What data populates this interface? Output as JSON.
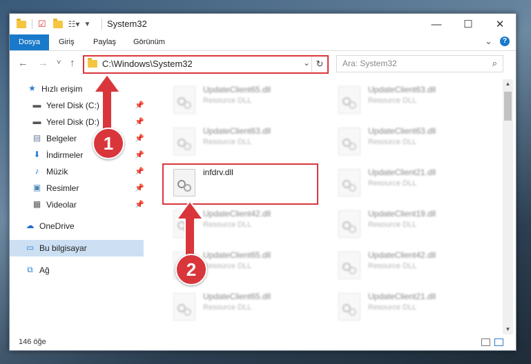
{
  "window": {
    "title": "System32"
  },
  "window_controls": {
    "minimize": "—",
    "maximize": "☐",
    "close": "✕"
  },
  "ribbon": {
    "tabs": [
      "Dosya",
      "Giriş",
      "Paylaş",
      "Görünüm"
    ],
    "collapse": "⌄",
    "help": "?"
  },
  "address": {
    "path": "C:\\Windows\\System32",
    "dropdown": "⌄",
    "refresh": "↻"
  },
  "search": {
    "placeholder": "Ara: System32",
    "icon": "⌕"
  },
  "nav": {
    "back": "←",
    "forward": "→",
    "recent": "˅",
    "up": "↑"
  },
  "sidebar": {
    "items": [
      {
        "label": "Hızlı erişim",
        "icon": "star-icon",
        "glyph": "★",
        "color": "#2b7cd3"
      },
      {
        "label": "Yerel Disk (C:)",
        "icon": "drive-icon",
        "glyph": "▬",
        "color": "#555555",
        "pin": "📌"
      },
      {
        "label": "Yerel Disk (D:)",
        "icon": "drive-icon",
        "glyph": "▬",
        "color": "#555555",
        "pin": "📌"
      },
      {
        "label": "Belgeler",
        "icon": "documents-icon",
        "glyph": "▤",
        "color": "#6a7f99",
        "pin": "📌"
      },
      {
        "label": "İndirmeler",
        "icon": "download-icon",
        "glyph": "⬇",
        "color": "#2b7cd3",
        "pin": "📌"
      },
      {
        "label": "Müzik",
        "icon": "music-icon",
        "glyph": "♪",
        "color": "#2b7cd3",
        "pin": "📌"
      },
      {
        "label": "Resimler",
        "icon": "pictures-icon",
        "glyph": "▣",
        "color": "#4a86b8",
        "pin": "📌"
      },
      {
        "label": "Videolar",
        "icon": "videos-icon",
        "glyph": "▦",
        "color": "#555555",
        "pin": "📌"
      },
      {
        "label": "OneDrive",
        "icon": "cloud-icon",
        "glyph": "☁",
        "color": "#1e6fc7"
      },
      {
        "label": "Bu bilgisayar",
        "icon": "computer-icon",
        "glyph": "▭",
        "color": "#2b7cd3"
      },
      {
        "label": "Ağ",
        "icon": "network-icon",
        "glyph": "⧉",
        "color": "#2b7cd3"
      }
    ]
  },
  "files": {
    "col1": [
      {
        "name": "UpdateClient65.dll",
        "type": "Resource DLL",
        "blurred": true
      },
      {
        "name": "UpdateClient63.dll",
        "type": "Resource DLL",
        "blurred": true
      },
      {
        "name": "infdrv.dll",
        "type": "",
        "blurred": false
      },
      {
        "name": "UpdateClient42.dll",
        "type": "Resource DLL",
        "blurred": true
      },
      {
        "name": "UpdateClient65.dll",
        "type": "Resource DLL",
        "blurred": true
      },
      {
        "name": "UpdateClient65.dll",
        "type": "Resource DLL",
        "blurred": true
      }
    ],
    "col2": [
      {
        "name": "UpdateClient63.dll",
        "type": "Resource DLL",
        "blurred": true
      },
      {
        "name": "UpdateClient63.dll",
        "type": "Resource DLL",
        "blurred": true
      },
      {
        "name": "UpdateClient21.dll",
        "type": "Resource DLL",
        "blurred": true
      },
      {
        "name": "UpdateClient19.dll",
        "type": "Resource DLL",
        "blurred": true
      },
      {
        "name": "UpdateClient42.dll",
        "type": "Resource DLL",
        "blurred": true
      },
      {
        "name": "UpdateClient21.dll",
        "type": "Resource DLL",
        "blurred": true
      }
    ]
  },
  "annotations": {
    "step1": "1",
    "step2": "2",
    "accent": "#d9363b"
  },
  "status": {
    "item_count": "146 öğe"
  },
  "scrollbar": {
    "position": 0.05
  }
}
